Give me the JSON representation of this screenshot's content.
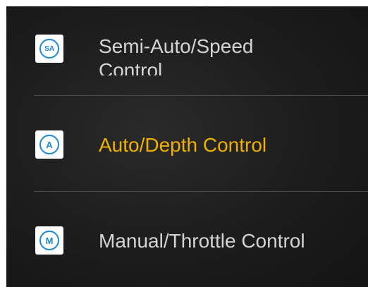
{
  "menu": {
    "items": [
      {
        "icon_letter": "SA",
        "icon_name": "semi-auto-icon",
        "label": "Semi-Auto/Speed Control",
        "selected": false
      },
      {
        "icon_letter": "A",
        "icon_name": "auto-icon",
        "label": "Auto/Depth Control",
        "selected": true
      },
      {
        "icon_letter": "M",
        "icon_name": "manual-icon",
        "label": "Manual/Throttle Control",
        "selected": false
      }
    ]
  },
  "colors": {
    "background": "#1c1c1c",
    "text": "#d4d4d4",
    "selected_text": "#f0b000",
    "icon_blue": "#1e88d6",
    "divider": "#4a4a4a"
  }
}
